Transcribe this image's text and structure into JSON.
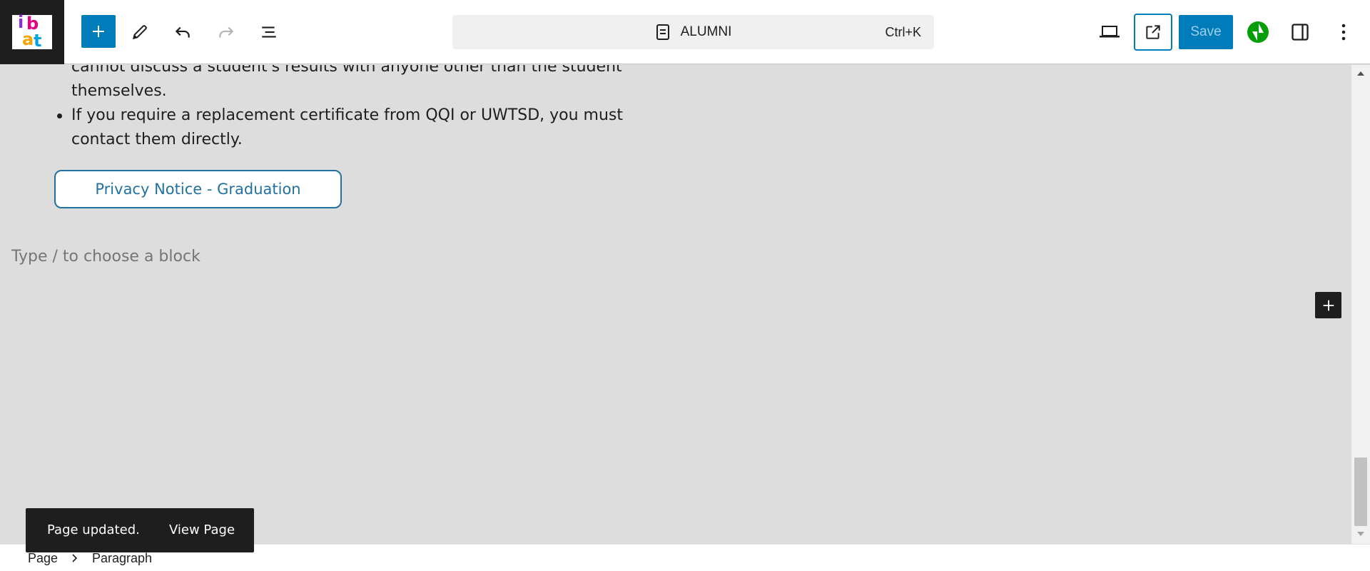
{
  "toolbar": {
    "site_logo_text": "ibat",
    "command_bar": {
      "title": "ALUMNI",
      "shortcut": "Ctrl+K"
    },
    "save_label": "Save"
  },
  "content": {
    "list_items": [
      "cannot discuss a student's results with anyone other than the student themselves.",
      "If you require a replacement certificate from QQI or UWTSD, you must contact them directly."
    ],
    "button_label": "Privacy Notice - Graduation",
    "block_placeholder": "Type / to choose a block"
  },
  "notice": {
    "message": "Page updated.",
    "action": "View Page"
  },
  "breadcrumbs": [
    "Page",
    "Paragraph"
  ],
  "colors": {
    "accent": "#007cba",
    "button_text": "#2271a1",
    "canvas_bg": "#dddddd",
    "jetpack_green": "#069e08"
  }
}
